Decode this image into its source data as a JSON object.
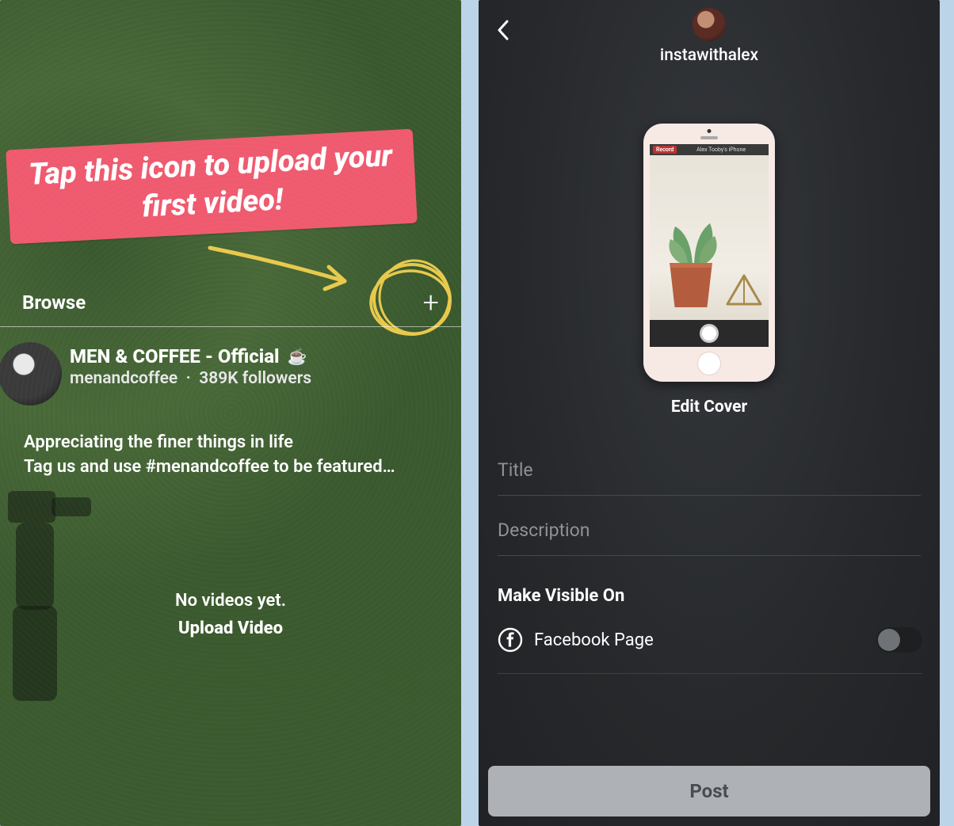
{
  "left": {
    "callout": "Tap this icon to upload your first video!",
    "browse_label": "Browse",
    "plus_icon": "+",
    "channel": {
      "title": "MEN & COFFEE - Official",
      "cup_emoji": "☕",
      "handle": "menandcoffee",
      "followers": "389K followers",
      "bio_line1": "Appreciating the finer things in life",
      "bio_line2": "Tag us and use #menandcoffee to be featured…"
    },
    "empty_state": {
      "line1": "No videos yet.",
      "cta": "Upload Video"
    }
  },
  "right": {
    "username": "instawithalex",
    "phone": {
      "rec_label": "Record",
      "device_title": "Alex Tooby's iPhone"
    },
    "edit_cover_label": "Edit Cover",
    "title_placeholder": "Title",
    "description_placeholder": "Description",
    "visibility_heading": "Make Visible On",
    "visibility_option": "Facebook Page",
    "toggle_on": false,
    "post_label": "Post"
  }
}
